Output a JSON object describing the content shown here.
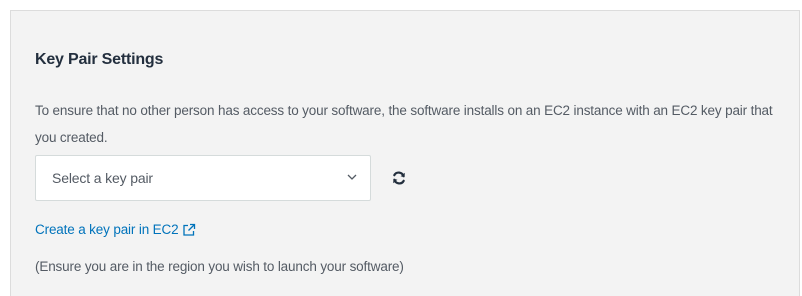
{
  "section": {
    "title": "Key Pair Settings",
    "description": "To ensure that no other person has access to your software, the software installs on an EC2 instance with an EC2 key pair that you created."
  },
  "key_pair_select": {
    "selected_value": "Select a key pair",
    "icon": "chevron-down-icon"
  },
  "refresh": {
    "icon": "refresh-icon"
  },
  "create_link": {
    "label": "Create a key pair in EC2",
    "icon": "external-link-icon"
  },
  "note": "(Ensure you are in the region you wish to launch your software)",
  "colors": {
    "panel_bg": "#f3f3f3",
    "title": "#232f3e",
    "text": "#545b64",
    "link": "#0073bb"
  }
}
